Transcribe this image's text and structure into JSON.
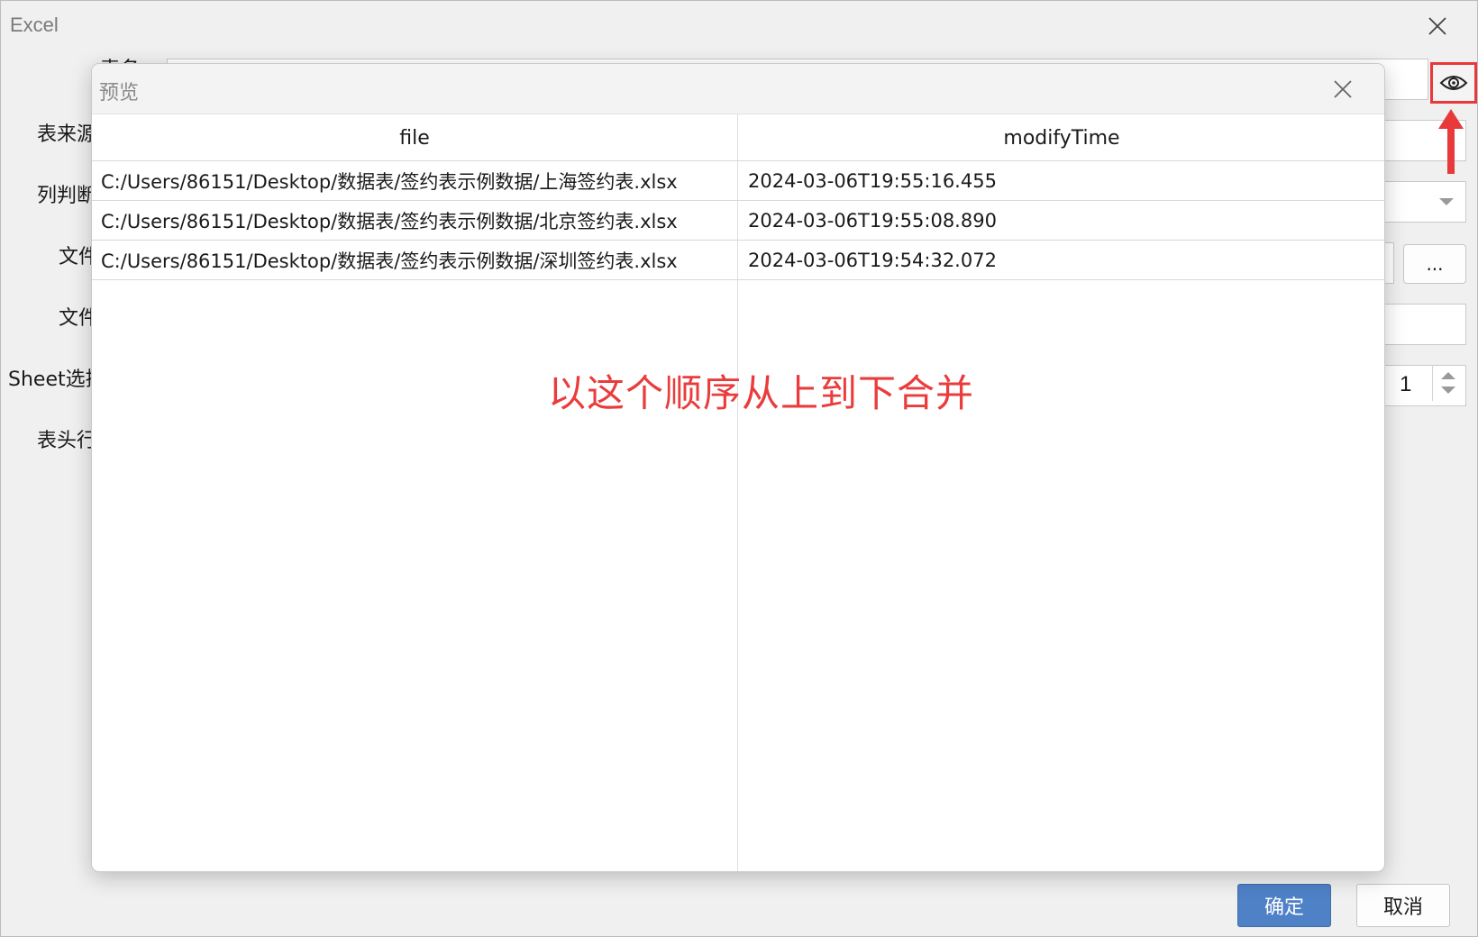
{
  "main_window": {
    "title": "Excel",
    "labels": {
      "table_name_partial": "表名",
      "table_source": "表来源",
      "column_judge": "列判断",
      "file_1": "文件",
      "file_2": "文件",
      "sheet_select": "Sheet选择",
      "header_row": "表头行"
    },
    "browse_button": "...",
    "sheet_number": "1",
    "ok_button": "确定",
    "cancel_button": "取消"
  },
  "preview": {
    "title": "预览",
    "columns": [
      "file",
      "modifyTime"
    ],
    "rows": [
      {
        "file": "C:/Users/86151/Desktop/数据表/签约表示例数据/上海签约表.xlsx",
        "modifyTime": "2024-03-06T19:55:16.455"
      },
      {
        "file": "C:/Users/86151/Desktop/数据表/签约表示例数据/北京签约表.xlsx",
        "modifyTime": "2024-03-06T19:55:08.890"
      },
      {
        "file": "C:/Users/86151/Desktop/数据表/签约表示例数据/深圳签约表.xlsx",
        "modifyTime": "2024-03-06T19:54:32.072"
      }
    ],
    "annotation": "以这个顺序从上到下合并"
  },
  "icons": {
    "main_close": "close-icon",
    "dialog_close": "close-icon",
    "preview_toggle": "eye-icon",
    "dropdown": "chevron-down-icon",
    "spin": "spin-arrows-icon",
    "annotation_arrow": "arrow-up-icon"
  },
  "colors": {
    "highlight_red": "#e83a3a",
    "primary_button": "#4f81c7",
    "annotation_text": "#ea3c3c"
  }
}
